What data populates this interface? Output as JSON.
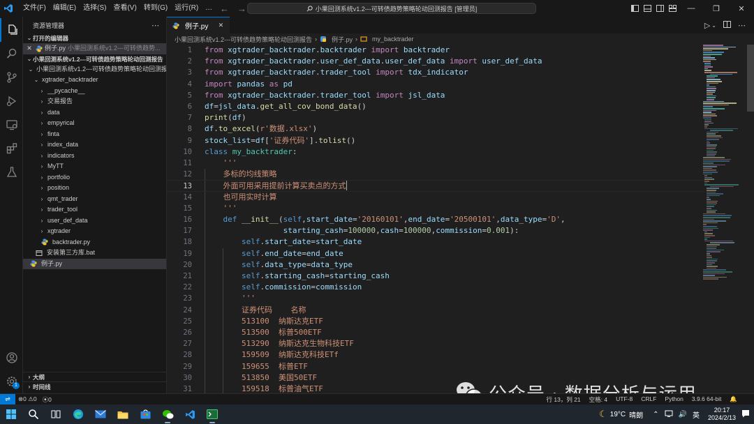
{
  "titlebar": {
    "menus": [
      "文件(F)",
      "编辑(E)",
      "选择(S)",
      "查看(V)",
      "转到(G)",
      "运行(R)",
      "…"
    ],
    "command_center": "小果回测系统v1.2---可转债趋势策略轮动回测报告 [管理员]"
  },
  "sidebar": {
    "title": "资源管理器",
    "open_editors_header": "打开的编辑器",
    "open_editor": {
      "name": "例子.py",
      "path": "小果回测系统v1.2---可转债趋势..."
    },
    "workspace_header": "小果回测系统v1.2---可转债趋势策略轮动回测报告",
    "tree": [
      {
        "label": "小果回测系统v1.2---可转债趋势策略轮动回测报告",
        "level": 1,
        "type": "folder-open"
      },
      {
        "label": "xgtrader_backtrader",
        "level": 2,
        "type": "folder-open"
      },
      {
        "label": "__pycache__",
        "level": 3,
        "type": "folder"
      },
      {
        "label": "交易报告",
        "level": 3,
        "type": "folder"
      },
      {
        "label": "data",
        "level": 3,
        "type": "folder"
      },
      {
        "label": "empyrical",
        "level": 3,
        "type": "folder"
      },
      {
        "label": "finta",
        "level": 3,
        "type": "folder"
      },
      {
        "label": "index_data",
        "level": 3,
        "type": "folder"
      },
      {
        "label": "indicators",
        "level": 3,
        "type": "folder"
      },
      {
        "label": "MyTT",
        "level": 3,
        "type": "folder"
      },
      {
        "label": "portfolio",
        "level": 3,
        "type": "folder"
      },
      {
        "label": "position",
        "level": 3,
        "type": "folder"
      },
      {
        "label": "qmt_trader",
        "level": 3,
        "type": "folder"
      },
      {
        "label": "trader_tool",
        "level": 3,
        "type": "folder"
      },
      {
        "label": "user_def_data",
        "level": 3,
        "type": "folder"
      },
      {
        "label": "xgtrader",
        "level": 3,
        "type": "folder"
      },
      {
        "label": "backtrader.py",
        "level": 3,
        "type": "py"
      },
      {
        "label": "安装第三方库.bat",
        "level": 2,
        "type": "bat"
      },
      {
        "label": "例子.py",
        "level": 1,
        "type": "py",
        "selected": true
      }
    ],
    "outline_header": "大纲",
    "timeline_header": "时间线"
  },
  "editor": {
    "tab_label": "例子.py",
    "breadcrumb": [
      "小果回测系统v1.2---可转债趋势策略轮动回测报告",
      "例子.py",
      "my_backtrader"
    ]
  },
  "code_lines": [
    "from xgtrader_backtrader.backtrader import backtrader",
    "from xgtrader_backtrader.user_def_data.user_def_data import user_def_data",
    "from xgtrader_backtrader.trader_tool import tdx_indicator",
    "import pandas as pd",
    "from xgtrader_backtrader.trader_tool import jsl_data",
    "df=jsl_data.get_all_cov_bond_data()",
    "print(df)",
    "df.to_excel(r'数据.xlsx')",
    "stock_list=df['证券代码'].tolist()",
    "class my_backtrader:",
    "    '''",
    "    多标的均线策略",
    "    外面可用采用提前计算买卖点的方式",
    "    也可用实时计算",
    "    '''",
    "    def __init__(self,start_date='20160101',end_date='20500101',data_type='D',",
    "                 starting_cash=100000,cash=100000,commission=0.001):",
    "        self.start_date=start_date",
    "        self.end_date=end_date",
    "        self.data_type=data_type",
    "        self.starting_cash=starting_cash",
    "        self.commission=commission",
    "        '''",
    "        证券代码    名称",
    "        513100  纳斯达克ETF",
    "        513500  标普500ETF",
    "        513290  纳斯达克生物科技ETF",
    "        159509  纳斯达克科技ETf",
    "        159655  标普ETF",
    "        513850  美国50ETF",
    "        159518  标普油气ETF"
  ],
  "current_line": 13,
  "watermark": "公众号 · 数据分析与运用",
  "statusbar": {
    "errors": "0",
    "warnings": "0",
    "ports": "0",
    "position": "行 13，列 21",
    "spaces": "空格: 4",
    "encoding": "UTF-8",
    "eol": "CRLF",
    "language": "Python",
    "interpreter": "3.9.6 64-bit"
  },
  "taskbar": {
    "weather_temp": "19°C",
    "weather_text": "晴朗",
    "ime": "英",
    "time": "20:17",
    "date": "2024/2/13"
  },
  "colors": {
    "accent": "#0078d4",
    "keyword": "#569cd6",
    "import_keyword": "#c586c0",
    "function": "#dcdcaa",
    "string": "#ce9178",
    "class": "#4ec9b0",
    "variable": "#9cdcfe"
  }
}
